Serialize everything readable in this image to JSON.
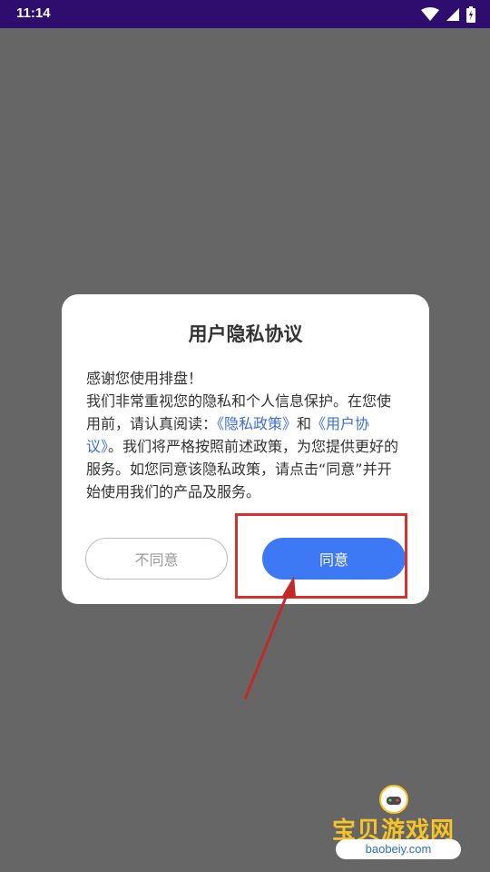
{
  "status_bar": {
    "time": "11:14",
    "icons": [
      "wifi-icon",
      "signal-icon",
      "battery-icon"
    ]
  },
  "dialog": {
    "title": "用户隐私协议",
    "greeting": "感谢您使用排盘！",
    "body_1": "我们非常重视您的隐私和个人信息保护。在您使用前，请认真阅读：",
    "link_privacy": "《隐私政策》",
    "conj": "和",
    "link_user": "《用户协议》",
    "body_2": "。我们将严格按照前述政策，为您提供更好的服务。如您同意该隐私政策，请点击“同意”并开始使用我们的产品及服务。",
    "disagree_label": "不同意",
    "agree_label": "同意"
  },
  "watermark": {
    "brand": "宝贝游戏网",
    "url": "baobeiy.com"
  },
  "colors": {
    "status_bar": "#2f0d6e",
    "overlay": "#666666",
    "accent": "#3e79f5",
    "link": "#3b6fd8",
    "highlight": "#d63030"
  }
}
